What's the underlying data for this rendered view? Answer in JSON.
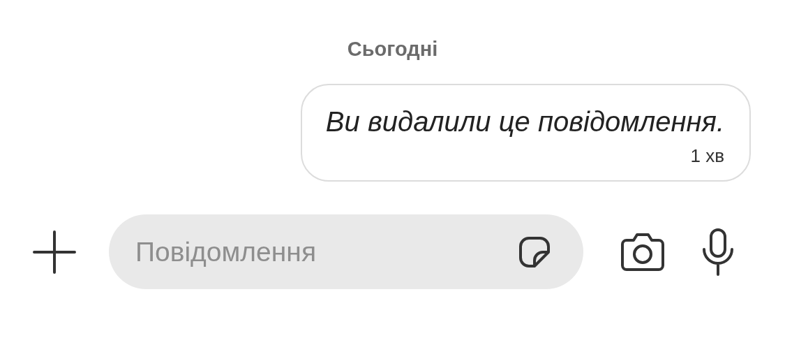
{
  "date_separator": "Сьогодні",
  "messages": [
    {
      "text": "Ви видалили це повідомлення.",
      "time": "1 хв",
      "deleted": true
    }
  ],
  "composer": {
    "placeholder": "Повідомлення"
  }
}
